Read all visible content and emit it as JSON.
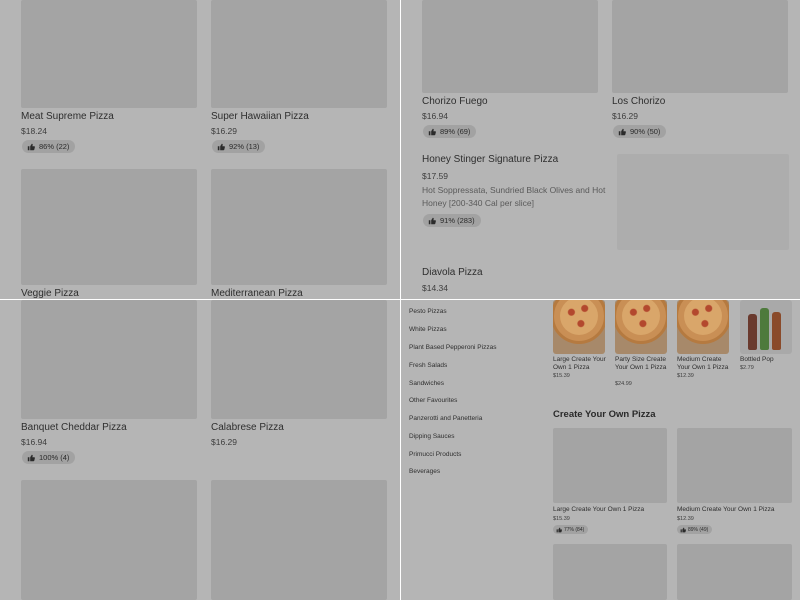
{
  "top_left": {
    "items": [
      {
        "name": "Meat Supreme Pizza",
        "price": "$18.24",
        "rating": "86% (22)"
      },
      {
        "name": "Super Hawaiian Pizza",
        "price": "$16.29",
        "rating": "92% (13)"
      },
      {
        "name": "Veggie Pizza"
      },
      {
        "name": "Mediterranean Pizza"
      }
    ]
  },
  "top_right": {
    "items": [
      {
        "name": "Chorizo Fuego",
        "price": "$16.94",
        "rating": "89% (69)"
      },
      {
        "name": "Los Chorizo",
        "price": "$16.29",
        "rating": "90% (50)"
      }
    ],
    "featured": {
      "name": "Honey Stinger Signature Pizza",
      "price": "$17.59",
      "description": "Hot Soppressata, Sundried Black Olives and Hot Honey [200-340 Cal per slice]",
      "rating": "91% (283)"
    },
    "next": {
      "name": "Diavola Pizza",
      "price": "$14.34"
    }
  },
  "bottom_left": {
    "items": [
      {
        "name": "Banquet Cheddar Pizza",
        "price": "$16.94",
        "rating": "100% (4)"
      },
      {
        "name": "Calabrese Pizza",
        "price": "$16.29"
      }
    ]
  },
  "bottom_right": {
    "menu": [
      "Pesto Pizzas",
      "White Pizzas",
      "Plant Based Pepperoni Pizzas",
      "Fresh Salads",
      "Sandwiches",
      "Other Favourites",
      "Panzerotti and Panetteria",
      "Dipping Sauces",
      "Primucci Products",
      "Beverages"
    ],
    "featured_tiles": [
      {
        "name": "Large Create Your Own 1 Pizza",
        "price": "$15.39"
      },
      {
        "name": "Party Size Create Your Own 1 Pizza",
        "price": "$24.99"
      },
      {
        "name": "Medium Create Your Own 1 Pizza",
        "price": "$12.39"
      },
      {
        "name": "Bottled Pop",
        "price": "$2.79"
      }
    ],
    "section_title": "Create Your Own Pizza",
    "section_items": [
      {
        "name": "Large Create Your Own 1 Pizza",
        "price": "$15.39",
        "rating": "77% (84)"
      },
      {
        "name": "Medium Create Your Own 1 Pizza",
        "price": "$12.39",
        "rating": "89% (49)"
      }
    ]
  },
  "colors": {
    "overlay": "#b5b5b5",
    "placeholder": "#a4a4a4",
    "divider": "#ffffff"
  }
}
